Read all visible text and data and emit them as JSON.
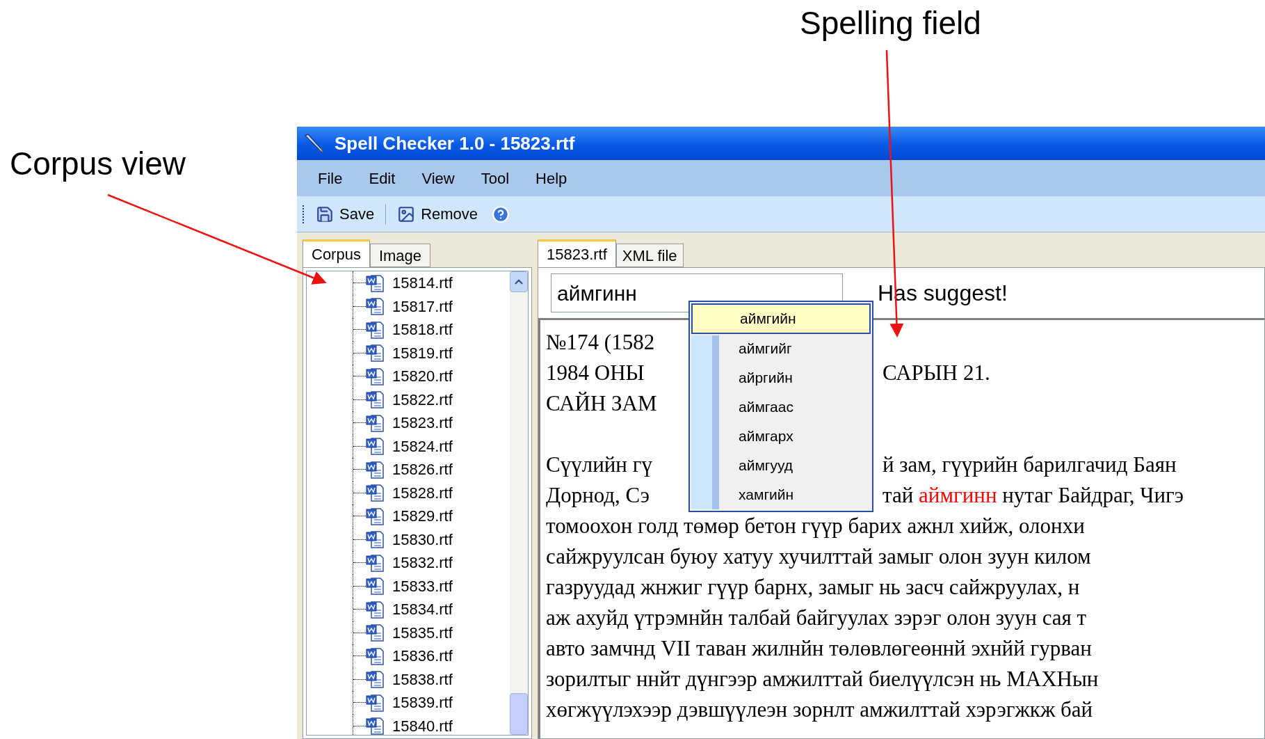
{
  "annotations": [
    {
      "text": "Corpus view"
    },
    {
      "text": "Spelling field"
    }
  ],
  "window": {
    "title": "Spell Checker 1.0 - 15823.rtf"
  },
  "menu": [
    "File",
    "Edit",
    "View",
    "Tool",
    "Help"
  ],
  "toolbar": [
    {
      "kind": "save",
      "label": "Save"
    },
    {
      "kind": "remove",
      "label": "Remove"
    },
    {
      "kind": "help"
    }
  ],
  "left_tabs": [
    {
      "label": "Corpus",
      "selected": true
    },
    {
      "label": "Image",
      "selected": false
    }
  ],
  "corpus_files": [
    "15814.rtf",
    "15817.rtf",
    "15818.rtf",
    "15819.rtf",
    "15820.rtf",
    "15822.rtf",
    "15823.rtf",
    "15824.rtf",
    "15826.rtf",
    "15828.rtf",
    "15829.rtf",
    "15830.rtf",
    "15832.rtf",
    "15833.rtf",
    "15834.rtf",
    "15835.rtf",
    "15836.rtf",
    "15838.rtf",
    "15839.rtf",
    "15840.rtf"
  ],
  "right_tabs": [
    {
      "label": "15823.rtf",
      "selected": true
    },
    {
      "label": "XML file",
      "selected": false
    }
  ],
  "spelling": {
    "value": "аймгинн",
    "status": "Has suggest!"
  },
  "suggestions": [
    {
      "text": "аймгийн",
      "selected": true
    },
    {
      "text": "аймгийг",
      "selected": false
    },
    {
      "text": "айргийн",
      "selected": false
    },
    {
      "text": "аймгаас",
      "selected": false
    },
    {
      "text": "аймгарх",
      "selected": false
    },
    {
      "text": "аймгууд",
      "selected": false
    },
    {
      "text": "хамгийн",
      "selected": false
    }
  ],
  "document": {
    "lines": [
      {
        "kind": "split",
        "left": "№174 (1582"
      },
      {
        "kind": "split",
        "left": "1984 ОНЫ",
        "right": [
          {
            "text": "САРЫН 21.",
            "error": false
          }
        ]
      },
      {
        "kind": "split",
        "left": "САЙН ЗАМ"
      },
      {
        "kind": "blank"
      },
      {
        "kind": "split",
        "left": "Сүүлийн гү",
        "right": [
          {
            "text": "й зам, гүүрийн барилгачид Баян",
            "error": false
          }
        ]
      },
      {
        "kind": "split",
        "left": "Дорнод, Сэ",
        "right": [
          {
            "text": "тай ",
            "error": false
          },
          {
            "text": "аймгинн",
            "error": true
          },
          {
            "text": " нутаг Байдраг, Чигэ",
            "error": false
          }
        ]
      },
      {
        "kind": "full",
        "full": "томоохон голд төмөр бетон гүүр барих ажнл хийж, олонхи"
      },
      {
        "kind": "full",
        "full": "сайжруулсан буюу хатуу хучилттай замыг олон зуун килом"
      },
      {
        "kind": "full",
        "full": "газруудад жнжиг гүүр барнх, замыг нь засч сайжруулах, н"
      },
      {
        "kind": "full",
        "full": "аж ахуйд үтрэмнйн талбай байгуулах зэрэг олон зуун сая т"
      },
      {
        "kind": "full",
        "full": "авто замчнд VII таван жилнйн төлөвлөгеөннй эхнйй гурван"
      },
      {
        "kind": "full",
        "full": "зорилтыг ннйт дүнгээр амжилттай биелүүлсэн нь МАХНын"
      },
      {
        "kind": "full",
        "full": "хөгжүүлэхээр дэвшүүлеэн зорнлт амжилттай хэрэгжкж бай"
      }
    ]
  }
}
